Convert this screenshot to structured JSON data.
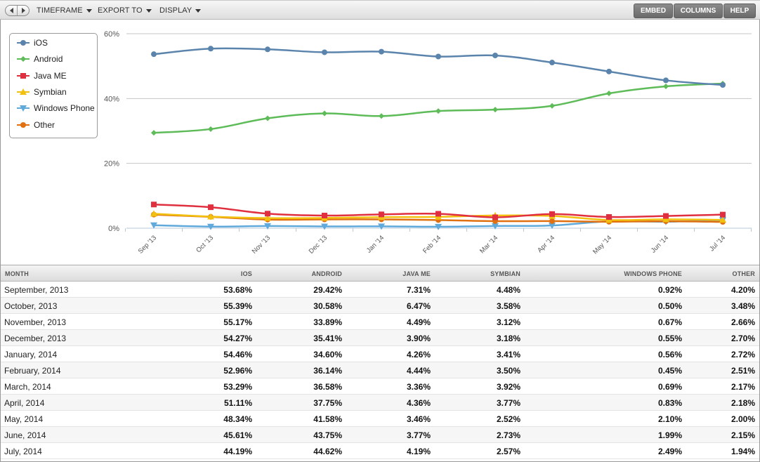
{
  "toolbar": {
    "menus": [
      {
        "label": "TIMEFRAME"
      },
      {
        "label": "EXPORT TO"
      },
      {
        "label": "DISPLAY"
      }
    ],
    "buttons": [
      {
        "label": "EMBED"
      },
      {
        "label": "COLUMNS"
      },
      {
        "label": "HELP"
      }
    ]
  },
  "legend": [
    {
      "name": "iOS",
      "color": "#5b84ad",
      "marker": "circle"
    },
    {
      "name": "Android",
      "color": "#5dbb58",
      "marker": "diamond"
    },
    {
      "name": "Java ME",
      "color": "#e0303f",
      "marker": "square"
    },
    {
      "name": "Symbian",
      "color": "#f2c10f",
      "marker": "triangle"
    },
    {
      "name": "Windows Phone",
      "color": "#5fa9db",
      "marker": "triangle-down"
    },
    {
      "name": "Other",
      "color": "#e07010",
      "marker": "circle"
    }
  ],
  "table": {
    "headers": [
      "MONTH",
      "IOS",
      "ANDROID",
      "JAVA ME",
      "SYMBIAN",
      "WINDOWS PHONE",
      "OTHER"
    ],
    "rows": [
      [
        "September, 2013",
        "53.68%",
        "29.42%",
        "7.31%",
        "4.48%",
        "0.92%",
        "4.20%"
      ],
      [
        "October, 2013",
        "55.39%",
        "30.58%",
        "6.47%",
        "3.58%",
        "0.50%",
        "3.48%"
      ],
      [
        "November, 2013",
        "55.17%",
        "33.89%",
        "4.49%",
        "3.12%",
        "0.67%",
        "2.66%"
      ],
      [
        "December, 2013",
        "54.27%",
        "35.41%",
        "3.90%",
        "3.18%",
        "0.55%",
        "2.70%"
      ],
      [
        "January, 2014",
        "54.46%",
        "34.60%",
        "4.26%",
        "3.41%",
        "0.56%",
        "2.72%"
      ],
      [
        "February, 2014",
        "52.96%",
        "36.14%",
        "4.44%",
        "3.50%",
        "0.45%",
        "2.51%"
      ],
      [
        "March, 2014",
        "53.29%",
        "36.58%",
        "3.36%",
        "3.92%",
        "0.69%",
        "2.17%"
      ],
      [
        "April, 2014",
        "51.11%",
        "37.75%",
        "4.36%",
        "3.77%",
        "0.83%",
        "2.18%"
      ],
      [
        "May, 2014",
        "48.34%",
        "41.58%",
        "3.46%",
        "2.52%",
        "2.10%",
        "2.00%"
      ],
      [
        "June, 2014",
        "45.61%",
        "43.75%",
        "3.77%",
        "2.73%",
        "1.99%",
        "2.15%"
      ],
      [
        "July, 2014",
        "44.19%",
        "44.62%",
        "4.19%",
        "2.57%",
        "2.49%",
        "1.94%"
      ]
    ]
  },
  "chart_data": {
    "type": "line",
    "title": "",
    "xlabel": "",
    "ylabel": "",
    "x": [
      "Sep '13",
      "Oct '13",
      "Nov '13",
      "Dec '13",
      "Jan '14",
      "Feb '14",
      "Mar '14",
      "Apr '14",
      "May '14",
      "Jun '14",
      "Jul '14"
    ],
    "ylim": [
      0,
      60
    ],
    "yticks": [
      "0%",
      "20%",
      "40%",
      "60%"
    ],
    "ytick_values": [
      0,
      20,
      40,
      60
    ],
    "grid": true,
    "legend_position": "top-left",
    "series": [
      {
        "name": "iOS",
        "values": [
          53.68,
          55.39,
          55.17,
          54.27,
          54.46,
          52.96,
          53.29,
          51.11,
          48.34,
          45.61,
          44.19
        ]
      },
      {
        "name": "Android",
        "values": [
          29.42,
          30.58,
          33.89,
          35.41,
          34.6,
          36.14,
          36.58,
          37.75,
          41.58,
          43.75,
          44.62
        ]
      },
      {
        "name": "Java ME",
        "values": [
          7.31,
          6.47,
          4.49,
          3.9,
          4.26,
          4.44,
          3.36,
          4.36,
          3.46,
          3.77,
          4.19
        ]
      },
      {
        "name": "Symbian",
        "values": [
          4.48,
          3.58,
          3.12,
          3.18,
          3.41,
          3.5,
          3.92,
          3.77,
          2.52,
          2.73,
          2.57
        ]
      },
      {
        "name": "Windows Phone",
        "values": [
          0.92,
          0.5,
          0.67,
          0.55,
          0.56,
          0.45,
          0.69,
          0.83,
          2.1,
          1.99,
          2.49
        ]
      },
      {
        "name": "Other",
        "values": [
          4.2,
          3.48,
          2.66,
          2.7,
          2.72,
          2.51,
          2.17,
          2.18,
          2.0,
          2.15,
          1.94
        ]
      }
    ]
  }
}
